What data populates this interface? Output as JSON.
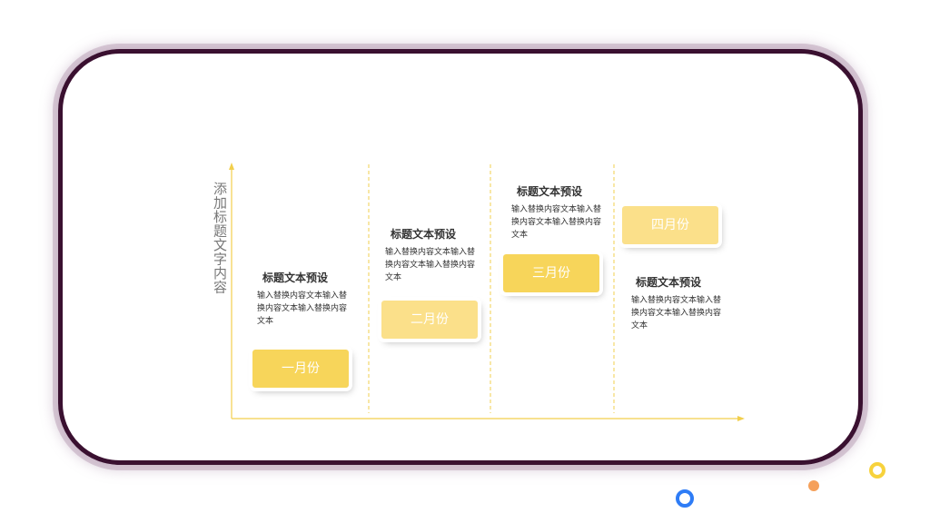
{
  "side_title": "添加标题文字内容",
  "colors": {
    "frame_border": "#3a1030",
    "axis": "#f2cf4c",
    "card_dark": "#f7d55a",
    "card_light": "#fbe08a",
    "ring_blue": "#2e7cf6",
    "dot_orange": "#f5a05a",
    "ring_yellow": "#f7d23c"
  },
  "steps": [
    {
      "label": "一月份",
      "title": "标题文本预设",
      "body": "输入替换内容文本输入替换内容文本输入替换内容文本"
    },
    {
      "label": "二月份",
      "title": "标题文本预设",
      "body": "输入替换内容文本输入替换内容文本输入替换内容文本"
    },
    {
      "label": "三月份",
      "title": "标题文本预设",
      "body": "输入替换内容文本输入替换内容文本输入替换内容文本"
    },
    {
      "label": "四月份",
      "title": "标题文本预设",
      "body": "输入替换内容文本输入替换内容文本输入替换内容文本"
    }
  ]
}
